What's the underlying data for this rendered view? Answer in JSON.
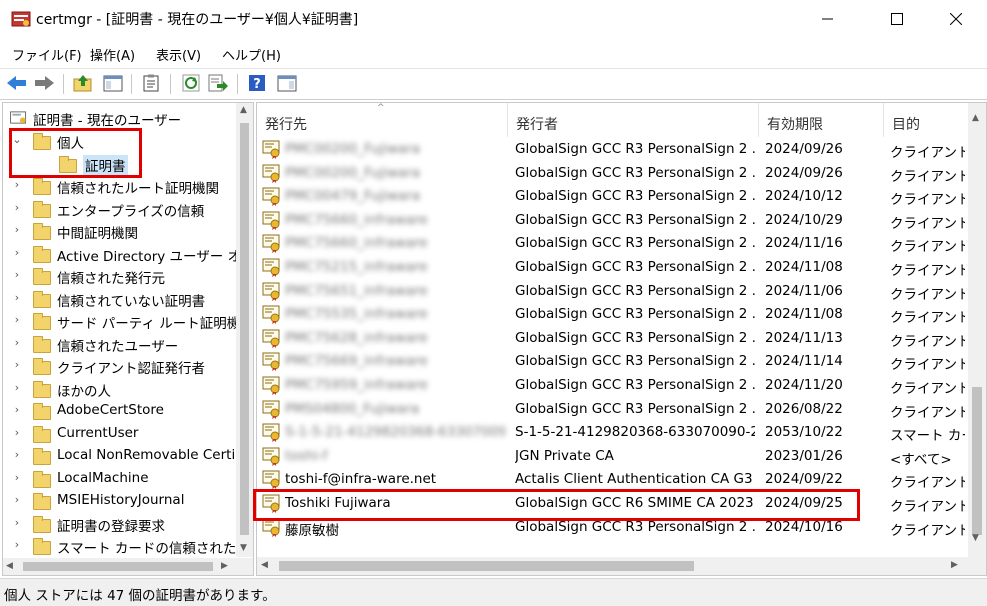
{
  "window": {
    "title": "certmgr - [証明書 - 現在のユーザー¥個人¥証明書]",
    "minimize": "—",
    "maximize": "☐",
    "close": "✕"
  },
  "menu": [
    "ファイル(F)",
    "操作(A)",
    "表示(V)",
    "ヘルプ(H)"
  ],
  "tree": {
    "root": "証明書 - 現在のユーザー",
    "items": [
      {
        "label": "個人",
        "expanded": true
      },
      {
        "label": "証明書",
        "selected": true
      },
      {
        "label": "信頼されたルート証明機関"
      },
      {
        "label": "エンタープライズの信頼"
      },
      {
        "label": "中間証明機関"
      },
      {
        "label": "Active Directory ユーザー オブ"
      },
      {
        "label": "信頼された発行元"
      },
      {
        "label": "信頼されていない証明書"
      },
      {
        "label": "サード パーティ ルート証明機関"
      },
      {
        "label": "信頼されたユーザー"
      },
      {
        "label": "クライアント認証発行者"
      },
      {
        "label": "ほかの人"
      },
      {
        "label": "AdobeCertStore"
      },
      {
        "label": "CurrentUser"
      },
      {
        "label": "Local NonRemovable Certi"
      },
      {
        "label": "LocalMachine"
      },
      {
        "label": "MSIEHistoryJournal"
      },
      {
        "label": "証明書の登録要求"
      },
      {
        "label": "スマート カードの信頼されたルー"
      }
    ]
  },
  "columns": [
    "発行先",
    "発行者",
    "有効期限",
    "目的"
  ],
  "rows": [
    {
      "issued_to": "PMC00200_Fujiwara",
      "issuer": "GlobalSign GCC R3 PersonalSign 2 ...",
      "expires": "2024/09/26",
      "purpose": "クライアント認",
      "blurred": true
    },
    {
      "issued_to": "PMC00200_Fujiwara",
      "issuer": "GlobalSign GCC R3 PersonalSign 2 ...",
      "expires": "2024/09/26",
      "purpose": "クライアント認",
      "blurred": true
    },
    {
      "issued_to": "PMC00479_Fujiwara",
      "issuer": "GlobalSign GCC R3 PersonalSign 2 ...",
      "expires": "2024/10/12",
      "purpose": "クライアント認",
      "blurred": true
    },
    {
      "issued_to": "PMC75660_infraware",
      "issuer": "GlobalSign GCC R3 PersonalSign 2 ...",
      "expires": "2024/10/29",
      "purpose": "クライアント認",
      "blurred": true
    },
    {
      "issued_to": "PMC75660_infraware",
      "issuer": "GlobalSign GCC R3 PersonalSign 2 ...",
      "expires": "2024/11/16",
      "purpose": "クライアント認",
      "blurred": true
    },
    {
      "issued_to": "PMC75215_infraware",
      "issuer": "GlobalSign GCC R3 PersonalSign 2 ...",
      "expires": "2024/11/08",
      "purpose": "クライアント認",
      "blurred": true
    },
    {
      "issued_to": "PMC75651_infraware",
      "issuer": "GlobalSign GCC R3 PersonalSign 2 ...",
      "expires": "2024/11/06",
      "purpose": "クライアント認",
      "blurred": true
    },
    {
      "issued_to": "PMC75535_infraware",
      "issuer": "GlobalSign GCC R3 PersonalSign 2 ...",
      "expires": "2024/11/08",
      "purpose": "クライアント認",
      "blurred": true
    },
    {
      "issued_to": "PMC75628_infraware",
      "issuer": "GlobalSign GCC R3 PersonalSign 2 ...",
      "expires": "2024/11/13",
      "purpose": "クライアント認",
      "blurred": true
    },
    {
      "issued_to": "PMC75669_infraware",
      "issuer": "GlobalSign GCC R3 PersonalSign 2 ...",
      "expires": "2024/11/14",
      "purpose": "クライアント認",
      "blurred": true
    },
    {
      "issued_to": "PMC75959_infraware",
      "issuer": "GlobalSign GCC R3 PersonalSign 2 ...",
      "expires": "2024/11/20",
      "purpose": "クライアント認",
      "blurred": true
    },
    {
      "issued_to": "PMS04800_Fujiwara",
      "issuer": "GlobalSign GCC R3 PersonalSign 2 ...",
      "expires": "2026/08/22",
      "purpose": "クライアント認",
      "blurred": true
    },
    {
      "issued_to": "S-1-5-21-4129820368-633070090-",
      "issuer": "S-1-5-21-4129820368-633070090-2...",
      "expires": "2053/10/22",
      "purpose": "スマート カート",
      "blurred_to": true
    },
    {
      "issued_to": "toshi-f",
      "issuer": "JGN Private CA",
      "expires": "2023/01/26",
      "purpose": "<すべて>",
      "blurred_to": true
    },
    {
      "issued_to": "toshi-f@infra-ware.net",
      "issuer": "Actalis Client Authentication CA G3",
      "expires": "2024/09/22",
      "purpose": "クライアント認"
    },
    {
      "issued_to": "Toshiki Fujiwara",
      "issuer": "GlobalSign GCC R6 SMIME CA 2023",
      "expires": "2024/09/25",
      "purpose": "クライアント認",
      "highlighted": true
    },
    {
      "issued_to": "藤原敏樹",
      "issuer": "GlobalSign GCC R3 PersonalSign 2 ...",
      "expires": "2024/10/16",
      "purpose": "クライアント認"
    }
  ],
  "status": "個人 ストアには 47 個の証明書があります。",
  "colors": {
    "highlight": "#e00000",
    "folder": "#f3d36b",
    "accent": "#1f6fc4"
  }
}
